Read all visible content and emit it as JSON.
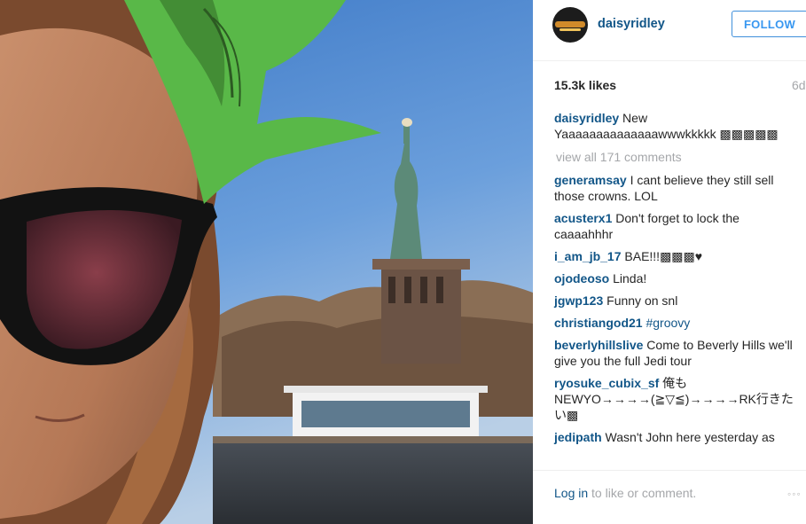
{
  "post": {
    "username": "daisyridley",
    "follow_label": "FOLLOW",
    "likes": "15.3k likes",
    "age": "6d",
    "caption": {
      "user": "daisyridley",
      "text": " New Yaaaaaaaaaaaaaawwwkkkkk ▩▩▩▩▩"
    },
    "view_all_comments": "view all 171 comments",
    "comments": [
      {
        "user": "generamsay",
        "text": " I cant believe they still sell those crowns. LOL"
      },
      {
        "user": "acusterx1",
        "text": " Don't forget to lock the caaaahhhr"
      },
      {
        "user": "i_am_jb_17",
        "text": " BAE!!!▩▩▩♥"
      },
      {
        "user": "ojodeoso",
        "text": " Linda!"
      },
      {
        "user": "jgwp123",
        "text": " Funny on snl"
      },
      {
        "user": "christiangod21",
        "text": " ",
        "tag": "#groovy"
      },
      {
        "user": "beverlyhillslive",
        "text": " Come to Beverly Hills we'll give you the full Jedi tour"
      },
      {
        "user": "ryosuke_cubix_sf",
        "text": " 俺も NEWYO→→→→(≧▽≦)→→→→RK行きたい▩"
      },
      {
        "user": "jedipath",
        "text": " Wasn't John here yesterday as"
      }
    ],
    "login_link": "Log in",
    "login_suffix": " to like or comment.",
    "more_dots": "◦◦◦"
  },
  "colors": {
    "username": "#125688",
    "follow": "#3897f0",
    "muted": "#a5a7aa"
  }
}
